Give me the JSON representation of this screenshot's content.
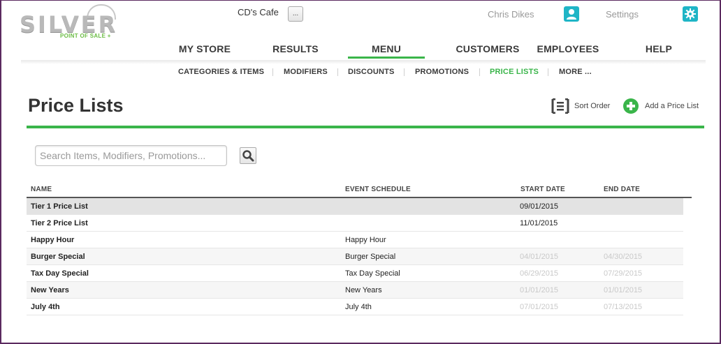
{
  "brand": {
    "logo_word": "SILVER",
    "logo_tagline": "POINT OF SALE +"
  },
  "header": {
    "store_name": "CD's Cafe",
    "store_menu_label": "...",
    "user_name": "Chris Dikes",
    "settings_label": "Settings"
  },
  "colors": {
    "accent_green": "#3ab54a",
    "icon_teal": "#1fb5c6",
    "faded_text": "#c9c9c9"
  },
  "main_nav": [
    {
      "label": "MY STORE",
      "active": false
    },
    {
      "label": "RESULTS",
      "active": false
    },
    {
      "label": "MENU",
      "active": true
    },
    {
      "label": "CUSTOMERS",
      "active": false
    },
    {
      "label": "EMPLOYEES",
      "active": false
    },
    {
      "label": "HELP",
      "active": false
    }
  ],
  "sub_nav": [
    {
      "label": "CATEGORIES & ITEMS",
      "active": false
    },
    {
      "label": "MODIFIERS",
      "active": false
    },
    {
      "label": "DISCOUNTS",
      "active": false
    },
    {
      "label": "PROMOTIONS",
      "active": false
    },
    {
      "label": "PRICE LISTS",
      "active": true
    },
    {
      "label": "MORE ...",
      "active": false
    }
  ],
  "page": {
    "title": "Price Lists",
    "sort_order_label": "Sort Order",
    "add_label": "Add a Price List"
  },
  "search": {
    "placeholder": "Search Items, Modifiers, Promotions..."
  },
  "table": {
    "columns": [
      "NAME",
      "EVENT SCHEDULE",
      "START DATE",
      "END DATE"
    ],
    "rows": [
      {
        "name": "Tier 1 Price List",
        "schedule": "",
        "start": "09/01/2015",
        "end": "",
        "faded": false,
        "selected": true
      },
      {
        "name": "Tier 2 Price List",
        "schedule": "",
        "start": "11/01/2015",
        "end": "",
        "faded": false,
        "selected": false
      },
      {
        "name": "Happy Hour",
        "schedule": "Happy Hour",
        "start": "",
        "end": "",
        "faded": false,
        "selected": false
      },
      {
        "name": "Burger Special",
        "schedule": "Burger Special",
        "start": "04/01/2015",
        "end": "04/30/2015",
        "faded": true,
        "selected": false
      },
      {
        "name": "Tax Day Special",
        "schedule": "Tax Day Special",
        "start": "06/29/2015",
        "end": "07/29/2015",
        "faded": true,
        "selected": false
      },
      {
        "name": "New Years",
        "schedule": "New Years",
        "start": "01/01/2015",
        "end": "01/01/2015",
        "faded": true,
        "selected": false
      },
      {
        "name": "July 4th",
        "schedule": "July 4th",
        "start": "07/01/2015",
        "end": "07/13/2015",
        "faded": true,
        "selected": false
      }
    ]
  }
}
